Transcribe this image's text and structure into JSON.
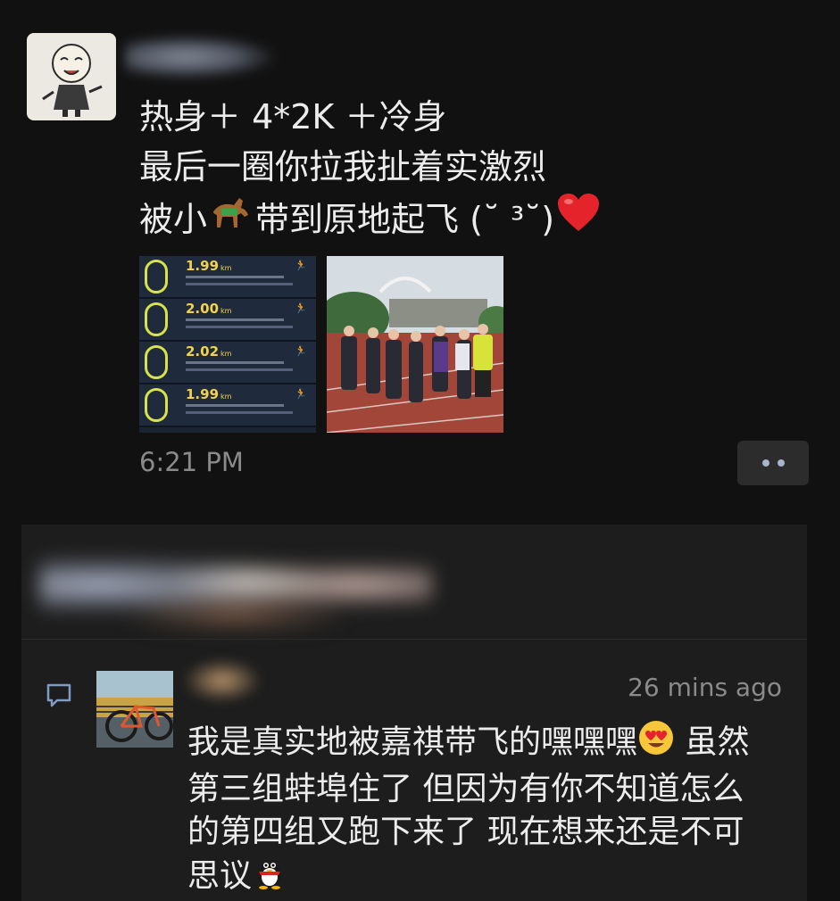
{
  "post": {
    "author_avatar": "monk-cartoon-avatar",
    "lines": [
      "热身＋ 4*2K ＋冷身",
      "最后一圈你拉我扯着实激烈"
    ],
    "line3_before": "被小",
    "line3_middle": "带到原地起飞 (˘ ³˘)",
    "line3_icons": [
      "horse-emoji",
      "red-heart-emoji"
    ],
    "thumbnails": {
      "runs": [
        {
          "distance": "1.99",
          "unit": "km"
        },
        {
          "distance": "2.00",
          "unit": "km"
        },
        {
          "distance": "2.02",
          "unit": "km"
        },
        {
          "distance": "1.99",
          "unit": "km"
        }
      ]
    },
    "timestamp": "6:21 PM"
  },
  "comment": {
    "time": "26 mins ago",
    "line1_before": "我是真实地被嘉祺带飞的嘿嘿嘿",
    "line1_after": " 虽然",
    "line2": "第三组蚌埠住了 但因为有你不知道怎么",
    "line3": "的第四组又跑下来了 现在想来还是不可",
    "line4": "思议",
    "icons": [
      "heart-eyes-emoji",
      "penguin-emoji"
    ]
  },
  "colors": {
    "background": "#111111",
    "comment_panel": "#1d1d1d",
    "accent_dots": "#a7b4cc",
    "comment_icon": "#7f9cc4"
  }
}
